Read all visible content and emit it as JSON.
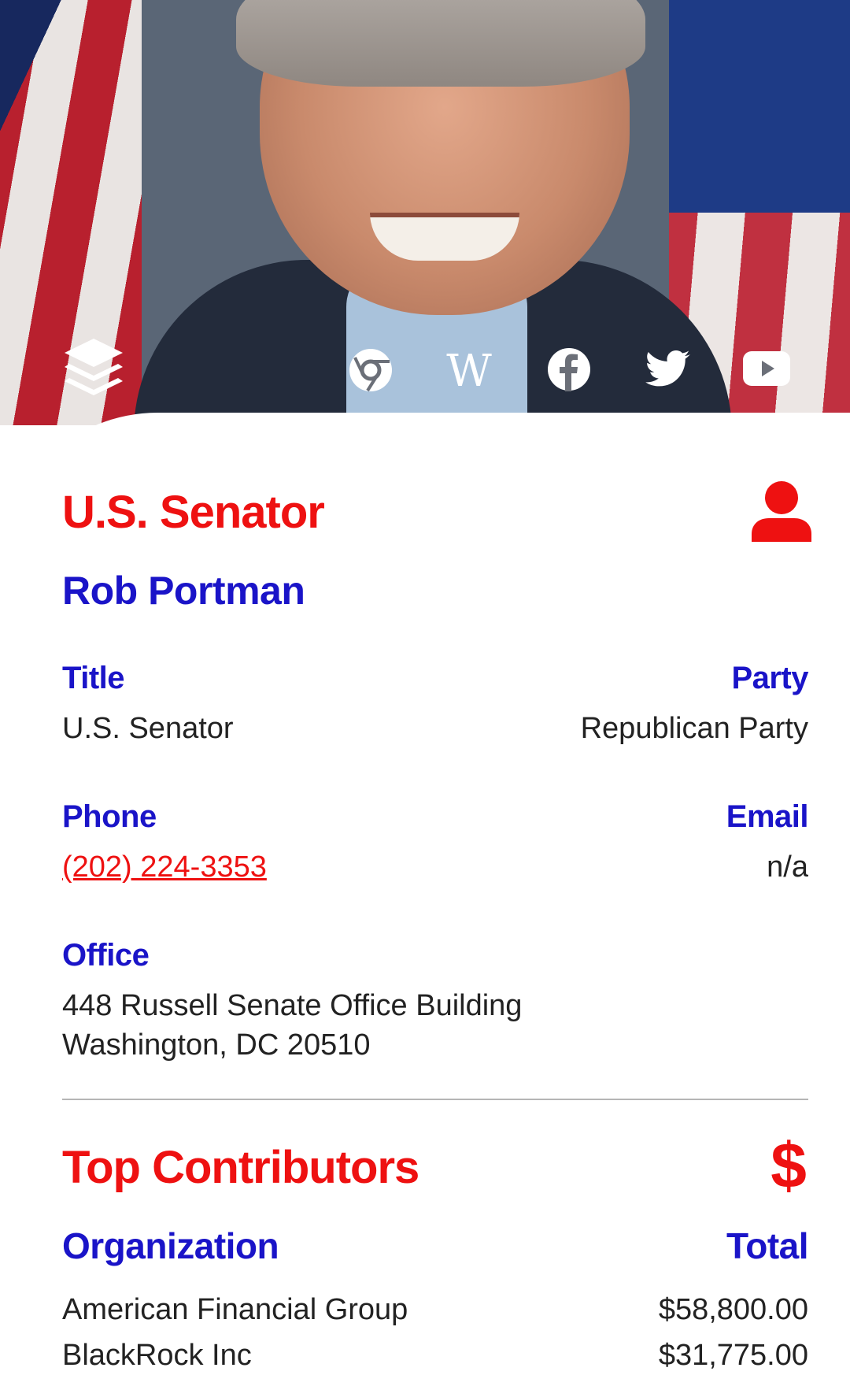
{
  "header": {
    "icons": [
      "layers-icon",
      "chrome-icon",
      "wikipedia-icon",
      "facebook-icon",
      "twitter-icon",
      "youtube-icon"
    ]
  },
  "profile": {
    "office_heading": "U.S. Senator",
    "name": "Rob Portman",
    "title_label": "Title",
    "title_value": "U.S. Senator",
    "party_label": "Party",
    "party_value": "Republican Party",
    "phone_label": "Phone",
    "phone_value": "(202) 224-3353",
    "email_label": "Email",
    "email_value": "n/a",
    "office_label": "Office",
    "office_line1": "448 Russell Senate Office Building",
    "office_line2": "Washington, DC 20510"
  },
  "contributors": {
    "heading": "Top Contributors",
    "col_org": "Organization",
    "col_total": "Total",
    "rows": [
      {
        "org": "American Financial Group",
        "total": "$58,800.00"
      },
      {
        "org": "BlackRock Inc",
        "total": "$31,775.00"
      }
    ]
  },
  "colors": {
    "accent_red": "#ee1111",
    "accent_blue": "#1a14c8"
  }
}
